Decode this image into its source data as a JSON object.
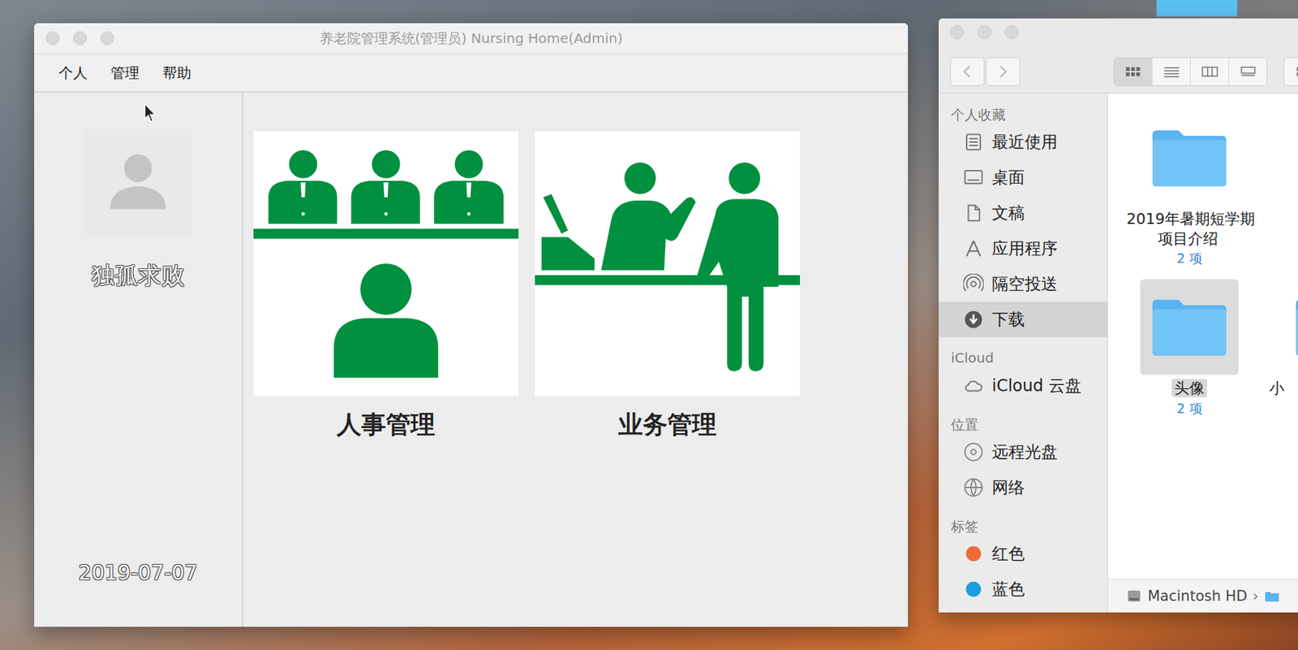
{
  "main_window": {
    "title": "养老院管理系统(管理员) Nursing Home(Admin)",
    "menu": [
      {
        "label": "个人"
      },
      {
        "label": "管理"
      },
      {
        "label": "帮助"
      }
    ],
    "user": {
      "name": "独孤求败",
      "date": "2019-07-07"
    },
    "tiles": [
      {
        "label": "人事管理",
        "kind": "staff"
      },
      {
        "label": "业务管理",
        "kind": "service"
      }
    ]
  },
  "finder": {
    "view_modes": [
      {
        "selected": true
      },
      {
        "selected": false
      },
      {
        "selected": false
      },
      {
        "selected": false
      }
    ],
    "sidebar": [
      {
        "kind": "header",
        "label": "个人收藏"
      },
      {
        "kind": "item",
        "label": "最近使用",
        "selected": false
      },
      {
        "kind": "item",
        "label": "桌面",
        "selected": false
      },
      {
        "kind": "item",
        "label": "文稿",
        "selected": false
      },
      {
        "kind": "item",
        "label": "应用程序",
        "selected": false
      },
      {
        "kind": "item",
        "label": "隔空投送",
        "selected": false
      },
      {
        "kind": "item",
        "label": "下载",
        "selected": true
      },
      {
        "kind": "header",
        "label": "iCloud"
      },
      {
        "kind": "item",
        "label": "iCloud 云盘",
        "selected": false
      },
      {
        "kind": "header",
        "label": "位置"
      },
      {
        "kind": "item",
        "label": "远程光盘",
        "selected": false
      },
      {
        "kind": "item",
        "label": "网络",
        "selected": false
      },
      {
        "kind": "header",
        "label": "标签"
      },
      {
        "kind": "tag",
        "label": "红色",
        "color": "#f26b3a"
      },
      {
        "kind": "tag",
        "label": "蓝色",
        "color": "#1b9be0"
      }
    ],
    "files": [
      {
        "name": "2019年暑期短学期项目介绍",
        "count": "2 项",
        "selected": false
      },
      {
        "name": "头像",
        "count": "2 项",
        "selected": true
      },
      {
        "name": "小",
        "selected": false
      }
    ],
    "path": {
      "label": "Macintosh HD",
      "separator": "›"
    }
  }
}
